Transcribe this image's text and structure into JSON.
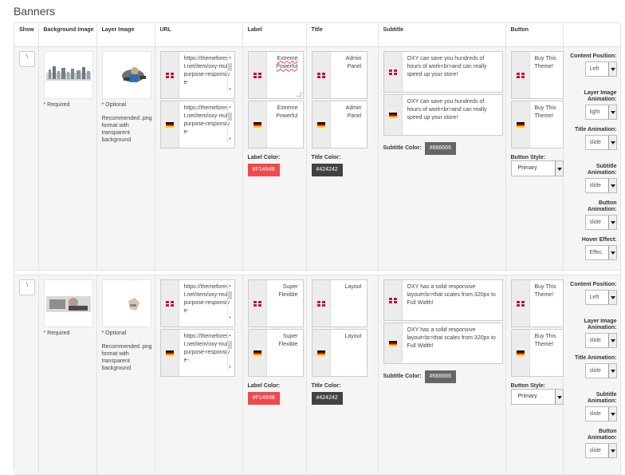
{
  "page_title": "Banners",
  "columns": [
    "Show",
    "Background Image",
    "Layer Image",
    "URL",
    "Label",
    "Title",
    "Subtitle",
    "Button",
    ""
  ],
  "required_text": "* Required",
  "optional_text": "* Optional",
  "layer_note": "Recommended .png format with transparent background",
  "label_color_text": "Label Color:",
  "title_color_text": "Title Color:",
  "subtitle_color_text": "Subtitle Color:",
  "button_style_text": "Button Style:",
  "colors": {
    "label": "#F1494B",
    "title": "#424242",
    "subtitle": "#666666"
  },
  "options_labels": {
    "content_position": "Content Position:",
    "layer_anim": "Layer Image Animation:",
    "title_anim": "Title Animation:",
    "subtitle_anim": "Subtitle Animation:",
    "button_anim": "Button Animation:",
    "hover": "Hover Effect:"
  },
  "rows": [
    {
      "show": "\\",
      "url_en": "https://themeforest.net/item/oxy-multipurpose-responsive-",
      "url_de": "https://themeforest.net/item/oxy-multipurpose-responsive-",
      "label_en_1": "Extreme",
      "label_en_2": "Powerful",
      "label_de": "Extreme Powerful",
      "title_en": "Admin Panel",
      "title_de": "Admin Panel",
      "subtitle_en": "OXY can save you hundreds of hours of work<br>and can really speed up your store!",
      "subtitle_de": "OXY can save you hundreds of hours of work<br>and can really speed up your store!",
      "button_en": "Buy This Theme!",
      "button_de": "Buy This Theme!",
      "label_color": "#F1494B",
      "title_color": "#424242",
      "subtitle_color": "#666666",
      "button_style": "Primary",
      "opt_position": "Left",
      "opt_layer": "light",
      "opt_title": "slide",
      "opt_subtitle": "slide",
      "opt_button": "slide",
      "opt_hover": "Effec"
    },
    {
      "show": "\\",
      "url_en": "https://themeforest.net/item/oxy-multipurpose-responsive-",
      "url_de": "https://themeforest.net/item/oxy-multipurpose-responsive-",
      "label_en_1": "Super",
      "label_en_2": "Flexible",
      "label_de": "Super Flexible",
      "title_en": "Layout",
      "title_de": "Layout",
      "subtitle_en": "OXY has a solid responsive layout<br>that scales from 320px to Full Width!",
      "subtitle_de": "OXY has a solid responsive layout<br>that scales from 320px to Full Width!",
      "button_en": "Buy This Theme!",
      "button_de": "Buy This Theme!",
      "label_color": "#F1494B",
      "title_color": "#424242",
      "subtitle_color": "#666666",
      "button_style": "Primary",
      "opt_position": "Left",
      "opt_layer": "slide",
      "opt_title": "slide",
      "opt_subtitle": "slide",
      "opt_button": "slide"
    }
  ]
}
